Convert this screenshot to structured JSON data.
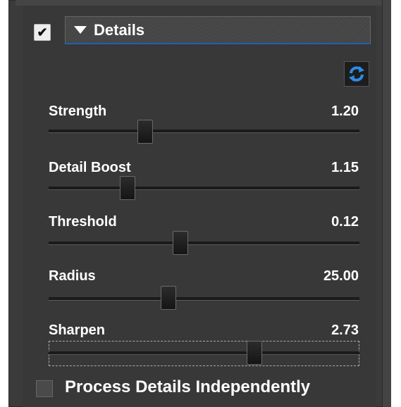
{
  "section": {
    "title": "Details",
    "enabled": true,
    "check_glyph": "✔",
    "collapse_icon": "triangle-down-icon",
    "refresh_icon": "refresh-icon",
    "accent_color": "#1f5fb8"
  },
  "sliders": [
    {
      "label": "Strength",
      "value": "1.20",
      "position": 0.3
    },
    {
      "label": "Detail Boost",
      "value": "1.15",
      "position": 0.24
    },
    {
      "label": "Threshold",
      "value": "0.12",
      "position": 0.42
    },
    {
      "label": "Radius",
      "value": "25.00",
      "position": 0.38
    },
    {
      "label": "Sharpen",
      "value": "2.73",
      "position": 0.67
    }
  ],
  "footer": {
    "label": "Process Details Independently",
    "checked": false
  }
}
